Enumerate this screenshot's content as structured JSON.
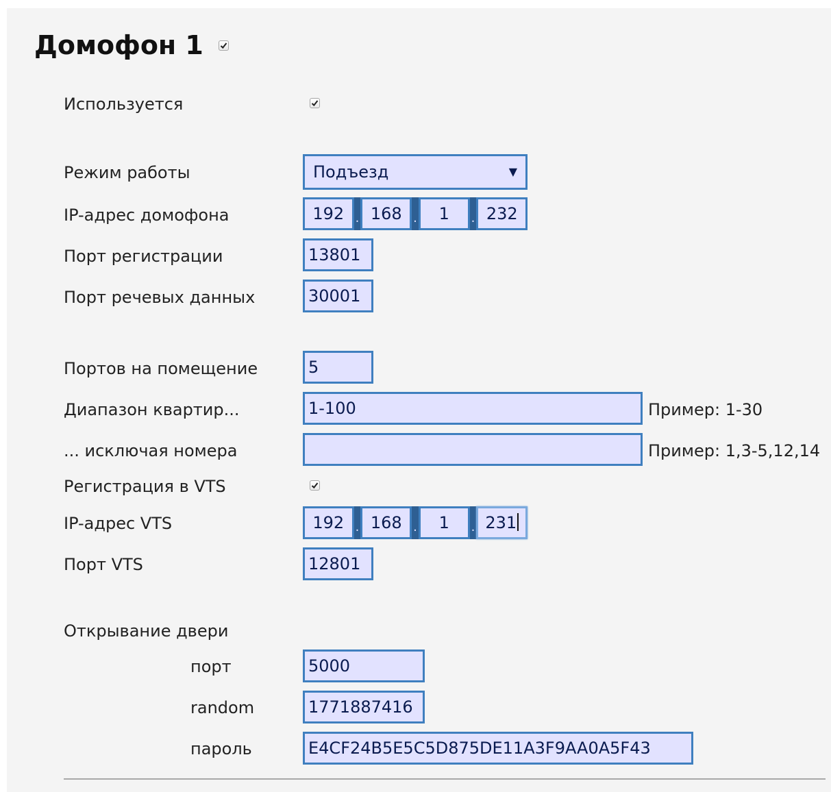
{
  "title": "Домофон 1",
  "title_checked": true,
  "fields": {
    "used": {
      "label": "Используется",
      "checked": true
    },
    "mode": {
      "label": "Режим работы",
      "value": "Подъезд"
    },
    "intercom_ip": {
      "label": "IP-адрес домофона",
      "octets": [
        "192",
        "168",
        "1",
        "232"
      ]
    },
    "reg_port": {
      "label": "Порт регистрации",
      "value": "13801"
    },
    "voice_port": {
      "label": "Порт речевых данных",
      "value": "30001"
    },
    "ports_per_room": {
      "label": "Портов на помещение",
      "value": "5"
    },
    "apartment_range": {
      "label": "Диапазон квартир...",
      "value": "1-100",
      "hint": "Пример: 1-30"
    },
    "exclude": {
      "label": "... исключая номера",
      "value": "",
      "hint": "Пример: 1,3-5,12,14"
    },
    "vts_registration": {
      "label": "Регистрация в VTS",
      "checked": true
    },
    "vts_ip": {
      "label": "IP-адрес VTS",
      "octets": [
        "192",
        "168",
        "1",
        "231"
      ]
    },
    "vts_port": {
      "label": "Порт VTS",
      "value": "12801"
    },
    "door_open": {
      "label": "Открывание двери",
      "port": {
        "label": "порт",
        "value": "5000"
      },
      "random": {
        "label": "random",
        "value": "1771887416"
      },
      "password": {
        "label": "пароль",
        "value": "E4CF24B5E5C5D875DE11A3F9AA0A5F43"
      }
    }
  }
}
